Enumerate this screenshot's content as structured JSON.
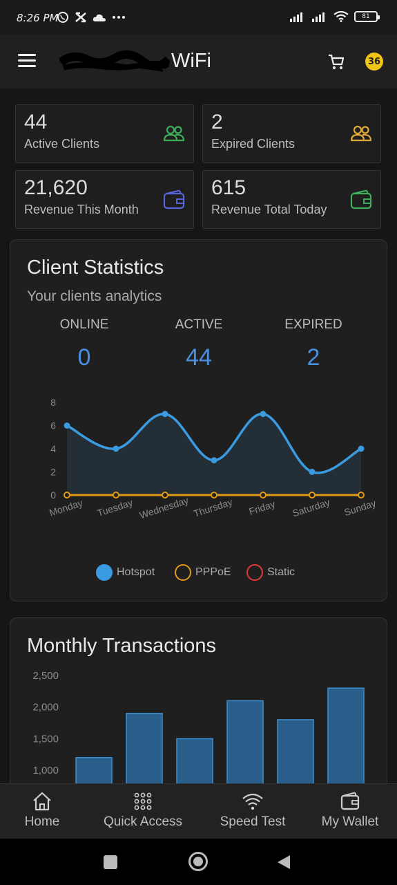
{
  "status_bar": {
    "time": "8:26 PM",
    "battery": "81"
  },
  "header": {
    "brand_suffix": "WiFi",
    "notification_count": "36"
  },
  "stats": [
    {
      "value": "44",
      "label": "Active Clients",
      "icon": "users-icon",
      "color": "#3fae5c"
    },
    {
      "value": "2",
      "label": "Expired Clients",
      "icon": "users-icon",
      "color": "#e0a93a"
    },
    {
      "value": "21,620",
      "label": "Revenue This Month",
      "icon": "wallet-icon",
      "color": "#5a63d8"
    },
    {
      "value": "615",
      "label": "Revenue Total Today",
      "icon": "wallet-icon",
      "color": "#3fae5c"
    }
  ],
  "client_statistics": {
    "title": "Client Statistics",
    "subtitle": "Your clients analytics",
    "summary": [
      {
        "label": "ONLINE",
        "value": "0"
      },
      {
        "label": "ACTIVE",
        "value": "44"
      },
      {
        "label": "EXPIRED",
        "value": "2"
      }
    ]
  },
  "monthly_transactions": {
    "title": "Monthly Transactions"
  },
  "bottom_nav": [
    {
      "label": "Home",
      "icon": "home-icon"
    },
    {
      "label": "Quick Access",
      "icon": "grid-icon"
    },
    {
      "label": "Speed Test",
      "icon": "wifi-icon"
    },
    {
      "label": "My Wallet",
      "icon": "wallet-icon"
    }
  ],
  "colors": {
    "accent": "#4a90e2",
    "hotspot": "#3b9be0",
    "pppoe": "#e09a1a",
    "static": "#e03a3a"
  },
  "chart_data": [
    {
      "type": "line",
      "title": "",
      "categories": [
        "Monday",
        "Tuesday",
        "Wednesday",
        "Thursday",
        "Friday",
        "Saturday",
        "Sunday"
      ],
      "series": [
        {
          "name": "Hotspot",
          "values": [
            6,
            4,
            7,
            3,
            7,
            2,
            4
          ]
        },
        {
          "name": "PPPoE",
          "values": [
            0,
            0,
            0,
            0,
            0,
            0,
            0
          ]
        },
        {
          "name": "Static",
          "values": [
            0,
            0,
            0,
            0,
            0,
            0,
            0
          ]
        }
      ],
      "yticks": [
        "0",
        "2",
        "4",
        "6",
        "8"
      ],
      "ylim": [
        0,
        8
      ],
      "legend": "bottom"
    },
    {
      "type": "bar",
      "title": "Monthly Transactions",
      "values": [
        1200,
        1900,
        1500,
        2100,
        1800,
        2300
      ],
      "yticks": [
        "1,000",
        "1,500",
        "2,000",
        "2,500"
      ],
      "ylim": [
        1000,
        2500
      ]
    }
  ]
}
